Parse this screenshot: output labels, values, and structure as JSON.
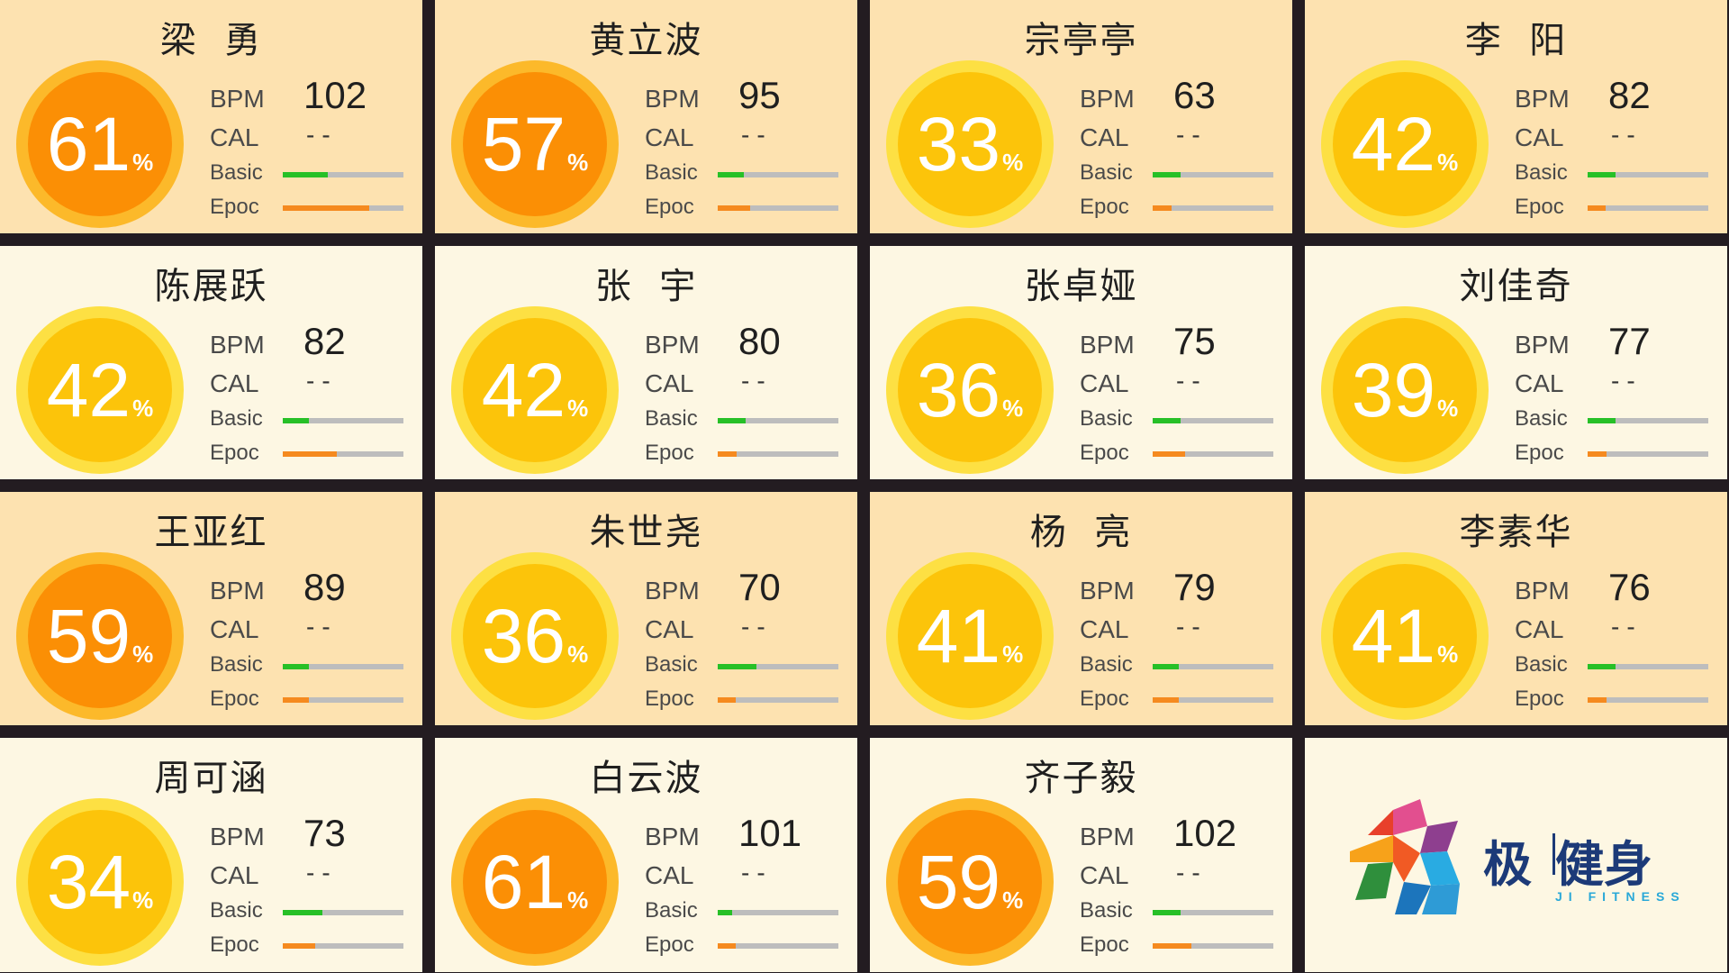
{
  "members": [
    {
      "name": "梁  勇",
      "percent": 61,
      "bpm": "102",
      "cal": "--",
      "basic": 0.37,
      "epoc": 0.72,
      "color": "orange",
      "bg": "peach"
    },
    {
      "name": "黄立波",
      "percent": 57,
      "bpm": "95",
      "cal": "--",
      "basic": 0.22,
      "epoc": 0.27,
      "color": "orange",
      "bg": "peach"
    },
    {
      "name": "宗亭亭",
      "percent": 33,
      "bpm": "63",
      "cal": "--",
      "basic": 0.23,
      "epoc": 0.16,
      "color": "yellow",
      "bg": "peach"
    },
    {
      "name": "李  阳",
      "percent": 42,
      "bpm": "82",
      "cal": "--",
      "basic": 0.23,
      "epoc": 0.15,
      "color": "yellow",
      "bg": "peach"
    },
    {
      "name": "陈展跃",
      "percent": 42,
      "bpm": "82",
      "cal": "--",
      "basic": 0.22,
      "epoc": 0.45,
      "color": "yellow",
      "bg": "light"
    },
    {
      "name": "张  宇",
      "percent": 42,
      "bpm": "80",
      "cal": "--",
      "basic": 0.23,
      "epoc": 0.16,
      "color": "yellow",
      "bg": "light"
    },
    {
      "name": "张卓娅",
      "percent": 36,
      "bpm": "75",
      "cal": "--",
      "basic": 0.23,
      "epoc": 0.27,
      "color": "yellow",
      "bg": "light"
    },
    {
      "name": "刘佳奇",
      "percent": 39,
      "bpm": "77",
      "cal": "--",
      "basic": 0.23,
      "epoc": 0.16,
      "color": "yellow",
      "bg": "light"
    },
    {
      "name": "王亚红",
      "percent": 59,
      "bpm": "89",
      "cal": "--",
      "basic": 0.22,
      "epoc": 0.22,
      "color": "orange",
      "bg": "peach"
    },
    {
      "name": "朱世尧",
      "percent": 36,
      "bpm": "70",
      "cal": "--",
      "basic": 0.32,
      "epoc": 0.15,
      "color": "yellow",
      "bg": "peach"
    },
    {
      "name": "杨  亮",
      "percent": 41,
      "bpm": "79",
      "cal": "--",
      "basic": 0.22,
      "epoc": 0.22,
      "color": "yellow",
      "bg": "peach"
    },
    {
      "name": "李素华",
      "percent": 41,
      "bpm": "76",
      "cal": "--",
      "basic": 0.23,
      "epoc": 0.16,
      "color": "yellow",
      "bg": "peach"
    },
    {
      "name": "周可涵",
      "percent": 34,
      "bpm": "73",
      "cal": "--",
      "basic": 0.33,
      "epoc": 0.27,
      "color": "yellow",
      "bg": "light"
    },
    {
      "name": "白云波",
      "percent": 61,
      "bpm": "101",
      "cal": "--",
      "basic": 0.12,
      "epoc": 0.15,
      "color": "orange",
      "bg": "light"
    },
    {
      "name": "齐子毅",
      "percent": 59,
      "bpm": "102",
      "cal": "--",
      "basic": 0.23,
      "epoc": 0.32,
      "color": "orange",
      "bg": "light"
    }
  ],
  "labels": {
    "bpm": "BPM",
    "cal": "CAL",
    "basic": "Basic",
    "epoc": "Epoc",
    "percent_sign": "%"
  },
  "logo": {
    "cn": "极健身",
    "en": "JI FITNESS"
  },
  "colors": {
    "peach_bg": "#fde2b0",
    "light_bg": "#fdf7e3",
    "yellow_disc": "#fcc40a",
    "yellow_ring": "#fde043",
    "orange_disc": "#fb8f05",
    "orange_ring": "#fcb92a",
    "basic_bar": "#27c027",
    "epoc_bar": "#f58a1f",
    "track": "#bdbdbd",
    "divider": "#231c21"
  }
}
